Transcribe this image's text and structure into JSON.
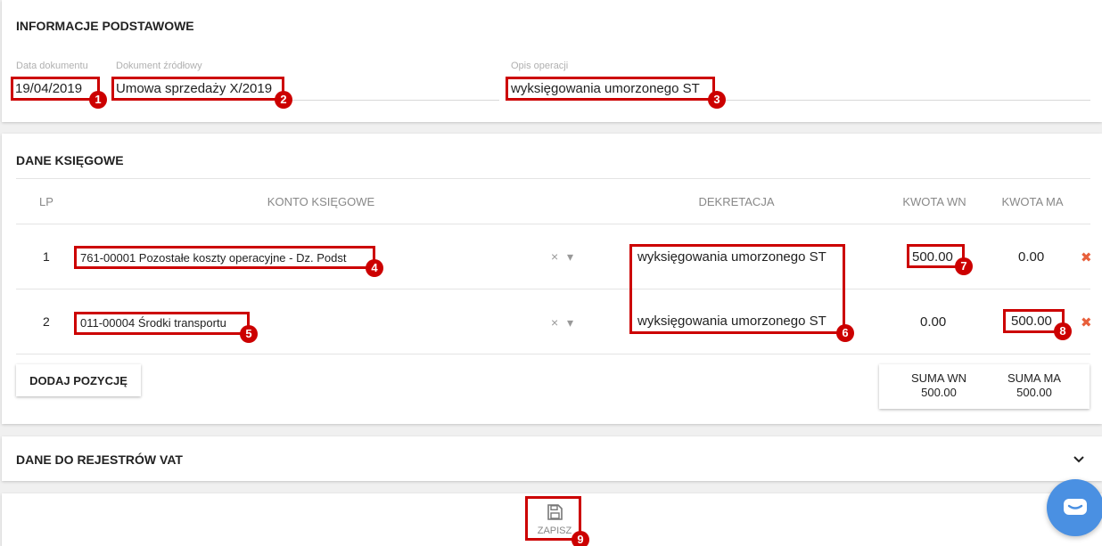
{
  "sections": {
    "basic": {
      "title": "INFORMACJE PODSTAWOWE",
      "doc_date_label": "Data dokumentu",
      "doc_date_value": "19/04/2019",
      "source_doc_label": "Dokument źródłowy",
      "source_doc_value": "Umowa sprzedaży X/2019",
      "description_label": "Opis operacji",
      "description_value": "wyksięgowania umorzonego ST"
    },
    "accounting": {
      "title": "DANE KSIĘGOWE",
      "columns": {
        "lp": "LP",
        "account": "KONTO KSIĘGOWE",
        "decree": "DEKRETACJA",
        "debit": "KWOTA WN",
        "credit": "KWOTA MA"
      },
      "rows": [
        {
          "lp": "1",
          "account": "761-00001 Pozostałe koszty operacyjne - Dz. Podst",
          "decree": "wyksięgowania umorzonego ST",
          "debit": "500.00",
          "credit": "0.00"
        },
        {
          "lp": "2",
          "account": "011-00004 Środki transportu",
          "decree": "wyksięgowania umorzonego ST",
          "debit": "0.00",
          "credit": "500.00"
        }
      ],
      "add_button": "DODAJ POZYCJĘ",
      "sum_debit_label": "SUMA WN",
      "sum_debit_value": "500.00",
      "sum_credit_label": "SUMA MA",
      "sum_credit_value": "500.00"
    },
    "vat": {
      "title": "DANE DO REJESTRÓW VAT"
    }
  },
  "footer": {
    "save_label": "ZAPISZ"
  },
  "icons": {
    "clear": "×",
    "dropdown": "▾",
    "delete": "✖",
    "expand": "chevron-down"
  },
  "callouts": [
    "1",
    "2",
    "3",
    "4",
    "5",
    "6",
    "7",
    "8",
    "9"
  ],
  "colors": {
    "callout": "#cc0000",
    "delete": "#e8603c",
    "chat": "#4a90e2"
  }
}
